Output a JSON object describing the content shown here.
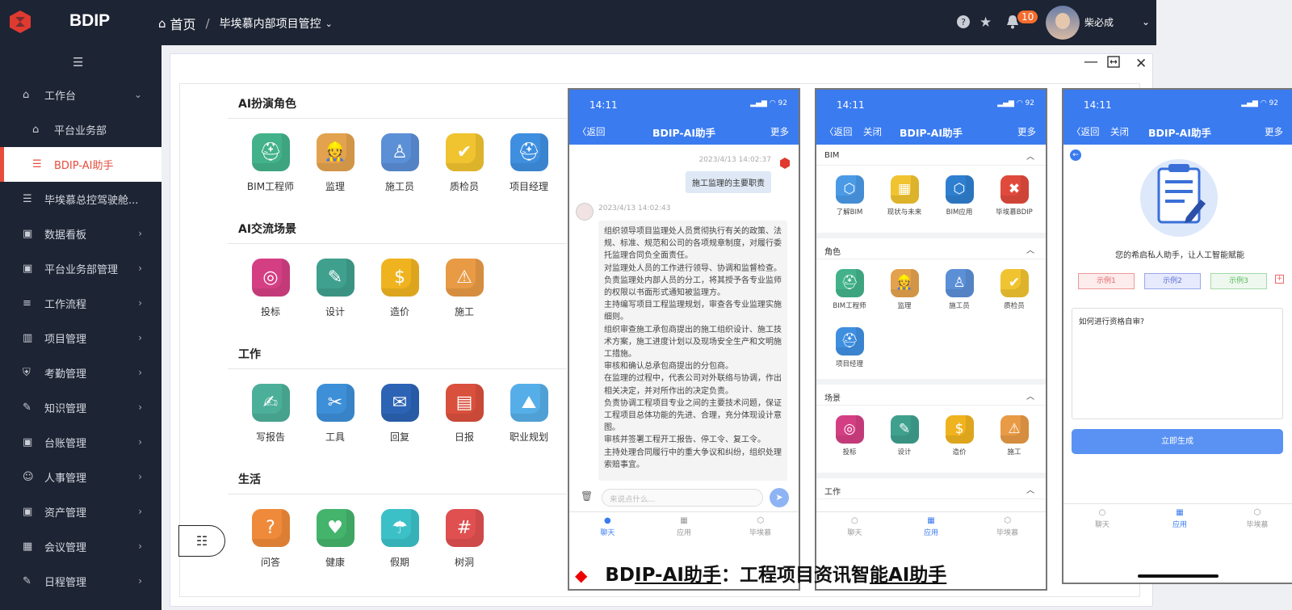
{
  "app": {
    "brand": "BDIP"
  },
  "header": {
    "home_label": "首页",
    "separator": "/",
    "project_label": "毕埃慕内部项目管控",
    "notification_count": "10",
    "user_name": "柴必成"
  },
  "sidebar": {
    "items": [
      {
        "label": "工作台",
        "icon": "home-icon",
        "expandable": true,
        "expanded": true
      },
      {
        "label": "平台业务部",
        "icon": "home-icon",
        "sub": true
      },
      {
        "label": "BDIP-AI助手",
        "icon": "list-icon",
        "sub": true,
        "active": true
      },
      {
        "label": "毕埃慕总控驾驶舱...",
        "icon": "list-icon"
      },
      {
        "label": "数据看板",
        "icon": "board-icon",
        "expandable": true
      },
      {
        "label": "平台业务部管理",
        "icon": "board-icon",
        "expandable": true
      },
      {
        "label": "工作流程",
        "icon": "flow-icon",
        "expandable": true
      },
      {
        "label": "项目管理",
        "icon": "chart-icon",
        "expandable": true
      },
      {
        "label": "考勤管理",
        "icon": "shield-icon",
        "expandable": true
      },
      {
        "label": "知识管理",
        "icon": "pen-icon",
        "expandable": true
      },
      {
        "label": "台账管理",
        "icon": "board-icon",
        "expandable": true
      },
      {
        "label": "人事管理",
        "icon": "user-icon",
        "expandable": true
      },
      {
        "label": "资产管理",
        "icon": "board-icon",
        "expandable": true
      },
      {
        "label": "会议管理",
        "icon": "calendar-icon",
        "expandable": true
      },
      {
        "label": "日程管理",
        "icon": "pen-icon",
        "expandable": true
      }
    ]
  },
  "main": {
    "sections": [
      {
        "title": "AI扮演角色",
        "apps": [
          {
            "label": "BIM工程师",
            "color": "#43b28a",
            "glyph": "⛑"
          },
          {
            "label": "监理",
            "color": "#e3a24e",
            "glyph": "👷"
          },
          {
            "label": "施工员",
            "color": "#5b8fd6",
            "glyph": "♙"
          },
          {
            "label": "质检员",
            "color": "#f0c330",
            "glyph": "✔"
          },
          {
            "label": "项目经理",
            "color": "#3f8fe0",
            "glyph": "⛑"
          }
        ]
      },
      {
        "title": "AI交流场景",
        "apps": [
          {
            "label": "投标",
            "color": "#d43f84",
            "glyph": "◎"
          },
          {
            "label": "设计",
            "color": "#3fa08e",
            "glyph": "✎"
          },
          {
            "label": "造价",
            "color": "#f0b320",
            "glyph": "$"
          },
          {
            "label": "施工",
            "color": "#e89a45",
            "glyph": "⚠"
          }
        ]
      },
      {
        "title": "工作",
        "apps": [
          {
            "label": "写报告",
            "color": "#4caf9a",
            "glyph": "✍"
          },
          {
            "label": "工具",
            "color": "#3d8fd8",
            "glyph": "✂"
          },
          {
            "label": "回复",
            "color": "#2c63b5",
            "glyph": "✉"
          },
          {
            "label": "日报",
            "color": "#d9503c",
            "glyph": "▤"
          },
          {
            "label": "职业规划",
            "color": "#56aee8",
            "glyph": "⛰"
          }
        ]
      },
      {
        "title": "生活",
        "apps": [
          {
            "label": "问答",
            "color": "#ef8a3a",
            "glyph": "?"
          },
          {
            "label": "健康",
            "color": "#44b46c",
            "glyph": "♥"
          },
          {
            "label": "假期",
            "color": "#3cc0c8",
            "glyph": "☂"
          },
          {
            "label": "树洞",
            "color": "#e05050",
            "glyph": "#"
          }
        ]
      }
    ]
  },
  "phone_common": {
    "time": "14:11",
    "battery": "92",
    "back": "返回",
    "close": "关闭",
    "title": "BDIP-AI助手",
    "more": "更多",
    "tabs": [
      "聊天",
      "应用",
      "毕埃慕"
    ]
  },
  "phone1": {
    "sent_time": "2023/4/13 14:02:37",
    "question": "施工监理的主要职责",
    "reply_time": "2023/4/13 14:02:43",
    "answer": [
      "组织领导项目监理处人员贯彻执行有关的政策、法规、标准、规范和公司的各项规章制度，对履行委托监理合同负全面责任。",
      "对监理处人员的工作进行领导、协调和监督检查。",
      "负责监理处内部人员的分工，将其授予各专业监师的权限以书面形式通知被监理方。",
      "主持编写项目工程监理规划，审查各专业监理实施细则。",
      "组织审查施工承包商提出的施工组织设计、施工技术方案，施工进度计划以及现场安全生产和文明施工措施。",
      "审核和确认总承包商提出的分包商。",
      "在监理的过程中，代表公司对外联络与协调，作出相关决定，并对所作出的决定负责。",
      "负责协调工程项目专业之间的主要技术问题，保证工程项目总体功能的先进、合理，充分体现设计意图。",
      "审核并签署工程开工报告、停工令、复工令。",
      "主持处理合同履行中的重大争议和纠纷，组织处理索赔事宜。"
    ],
    "input_placeholder": "来说点什么..."
  },
  "phone2": {
    "groups": [
      {
        "title": "BIM",
        "apps": [
          {
            "label": "了解BIM",
            "color": "#4a9ae6",
            "glyph": "⬡"
          },
          {
            "label": "现状与未来",
            "color": "#f0c330",
            "glyph": "▦"
          },
          {
            "label": "BIM应用",
            "color": "#2f7fd0",
            "glyph": "⬡"
          },
          {
            "label": "毕埃慕BDIP",
            "color": "#e04a3c",
            "glyph": "✖"
          }
        ]
      },
      {
        "title": "角色",
        "apps": [
          {
            "label": "BIM工程师",
            "color": "#43b28a",
            "glyph": "⛑"
          },
          {
            "label": "监理",
            "color": "#e3a24e",
            "glyph": "👷"
          },
          {
            "label": "施工员",
            "color": "#5b8fd6",
            "glyph": "♙"
          },
          {
            "label": "质检员",
            "color": "#f0c330",
            "glyph": "✔"
          },
          {
            "label": "项目经理",
            "color": "#3f8fe0",
            "glyph": "⛑"
          }
        ]
      },
      {
        "title": "场景",
        "apps": [
          {
            "label": "投标",
            "color": "#d43f84",
            "glyph": "◎"
          },
          {
            "label": "设计",
            "color": "#3fa08e",
            "glyph": "✎"
          },
          {
            "label": "造价",
            "color": "#f0b320",
            "glyph": "$"
          },
          {
            "label": "施工",
            "color": "#e89a45",
            "glyph": "⚠"
          }
        ]
      },
      {
        "title": "工作",
        "apps": []
      }
    ]
  },
  "phone3": {
    "subtitle": "您的希启私人助手，让人工智能赋能",
    "examples": [
      "示例1",
      "示例2",
      "示例3"
    ],
    "question_value": "如何进行资格自审?",
    "generate_label": "立即生成"
  },
  "caption": {
    "part1": "BD",
    "part2": "IP-AI助手",
    "part3": "：工程项目资讯智",
    "part4": "能AI助手"
  }
}
